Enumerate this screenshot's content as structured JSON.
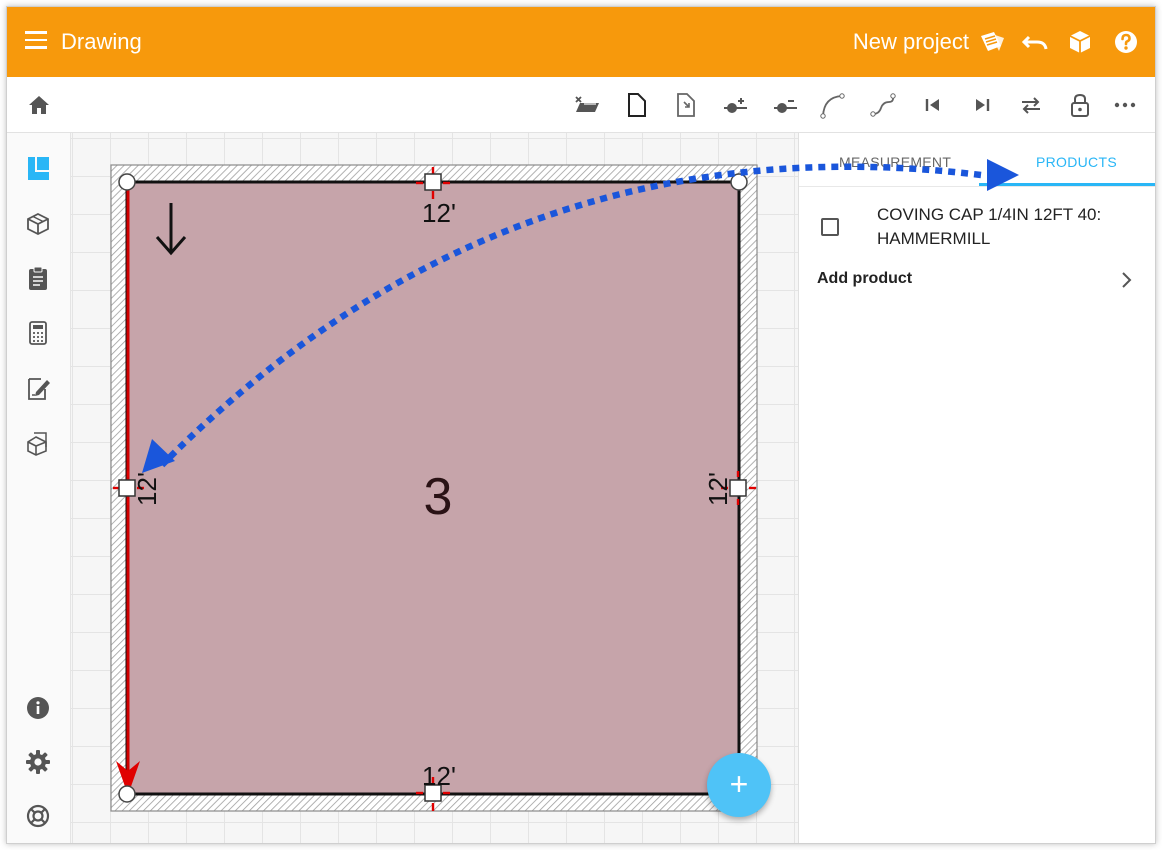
{
  "appbar": {
    "title": "Drawing",
    "project_label": "New project",
    "icons": [
      "menu-icon",
      "project-icon",
      "undo-icon",
      "3d-view-icon",
      "help-icon"
    ],
    "color": "#f7990c"
  },
  "toolbar": {
    "icons": [
      "home-icon",
      "clear-layer-icon",
      "page-icon",
      "page-fold-icon",
      "add-point-icon",
      "remove-point-icon",
      "curve-icon",
      "spline-icon",
      "skip-first-icon",
      "skip-last-icon",
      "swap-icon",
      "lock-icon",
      "more-icon"
    ]
  },
  "sidebar": {
    "icons": [
      "floorplan-icon",
      "3d-box-icon",
      "clipboard-icon",
      "calculator-icon",
      "edit-document-icon",
      "packages-icon",
      "info-icon",
      "settings-icon",
      "support-icon"
    ]
  },
  "room": {
    "number": "3",
    "wall_labels": {
      "top": "12'",
      "bottom": "12'",
      "left": "12'",
      "right": "12'"
    },
    "fill_color": "#c6a4aa"
  },
  "panel": {
    "tabs": [
      {
        "label": "MEASUREMENT",
        "active": false
      },
      {
        "label": "PRODUCTS",
        "active": true
      }
    ],
    "product": {
      "name": "COVING CAP 1/4IN 12FT 40: HAMMERMILL",
      "checked": false
    },
    "add_product_label": "Add product",
    "accent_color": "#29b6f6"
  },
  "fab": {
    "label": "+"
  },
  "annotation": {
    "arrow_color": "#1a56db"
  }
}
